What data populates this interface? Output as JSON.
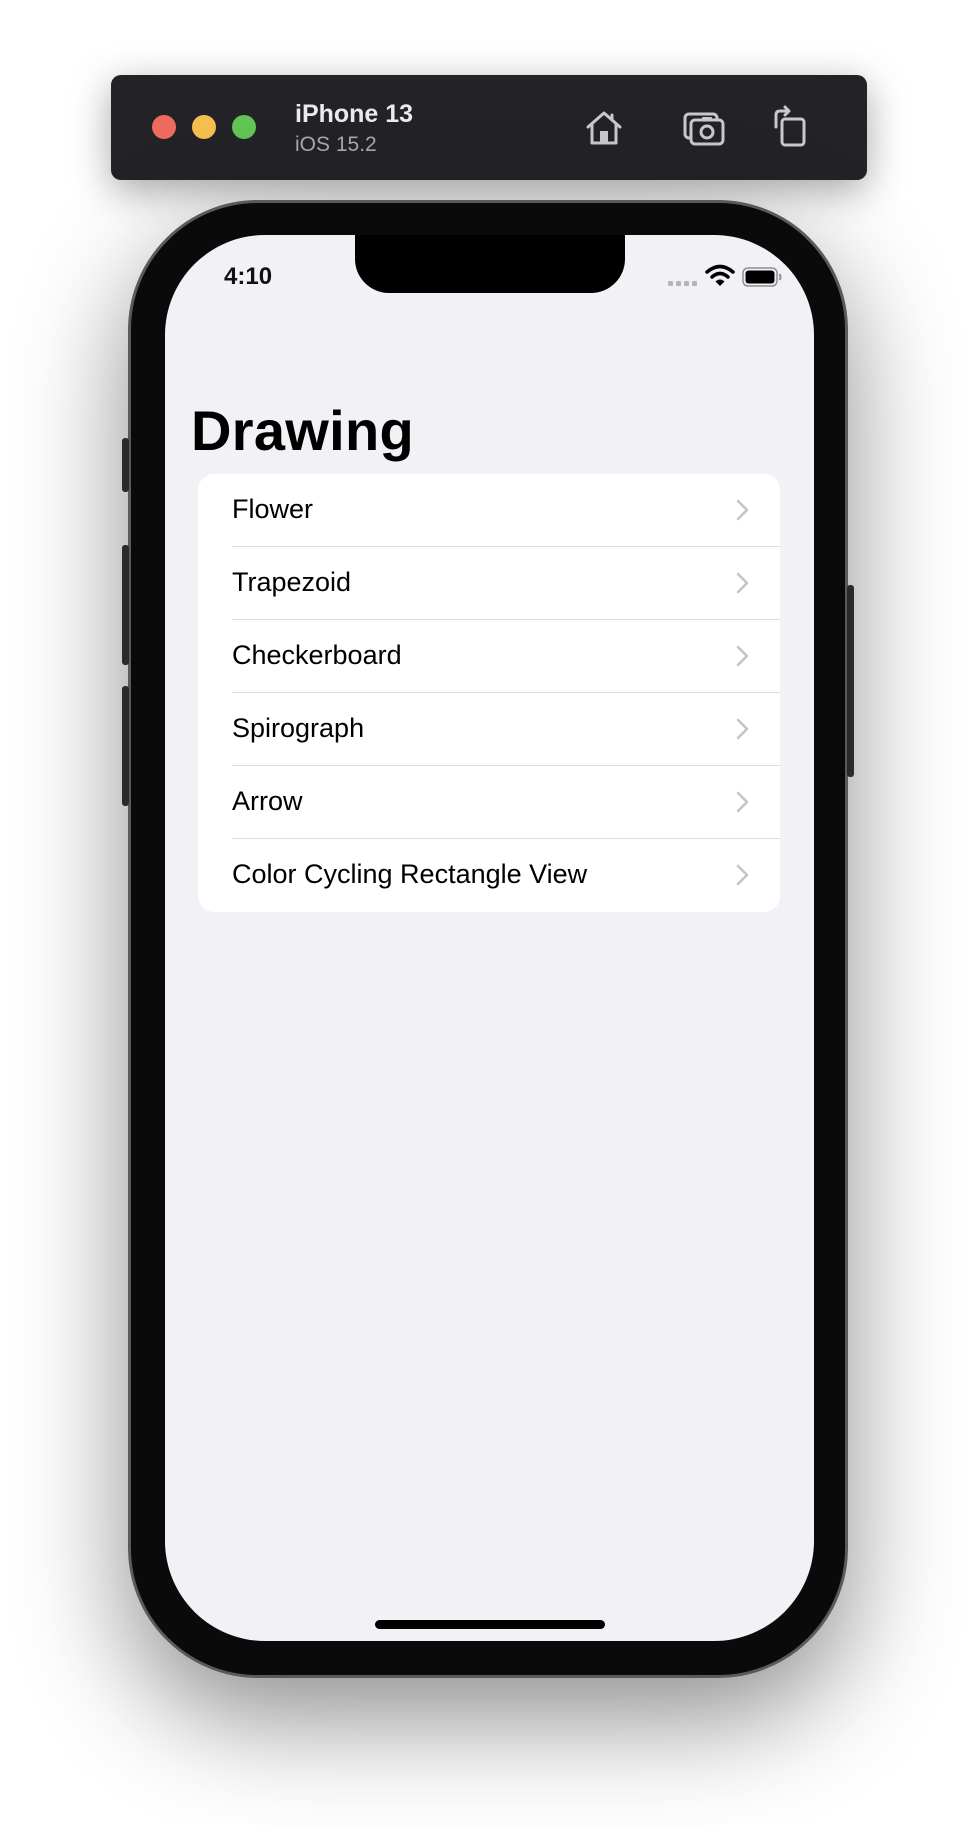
{
  "simulator": {
    "device_name": "iPhone 13",
    "os_version": "iOS 15.2",
    "toolbar_icons": [
      "home-icon",
      "screenshot-icon",
      "rotate-icon"
    ]
  },
  "status_bar": {
    "time": "4:10"
  },
  "navigation": {
    "title": "Drawing"
  },
  "list": {
    "items": [
      {
        "label": "Flower"
      },
      {
        "label": "Trapezoid"
      },
      {
        "label": "Checkerboard"
      },
      {
        "label": "Spirograph"
      },
      {
        "label": "Arrow"
      },
      {
        "label": "Color Cycling Rectangle View"
      }
    ]
  },
  "colors": {
    "background": "#f2f1f6",
    "cell": "#ffffff",
    "chevron": "#c4c4c7",
    "toolbar": "#232227"
  }
}
